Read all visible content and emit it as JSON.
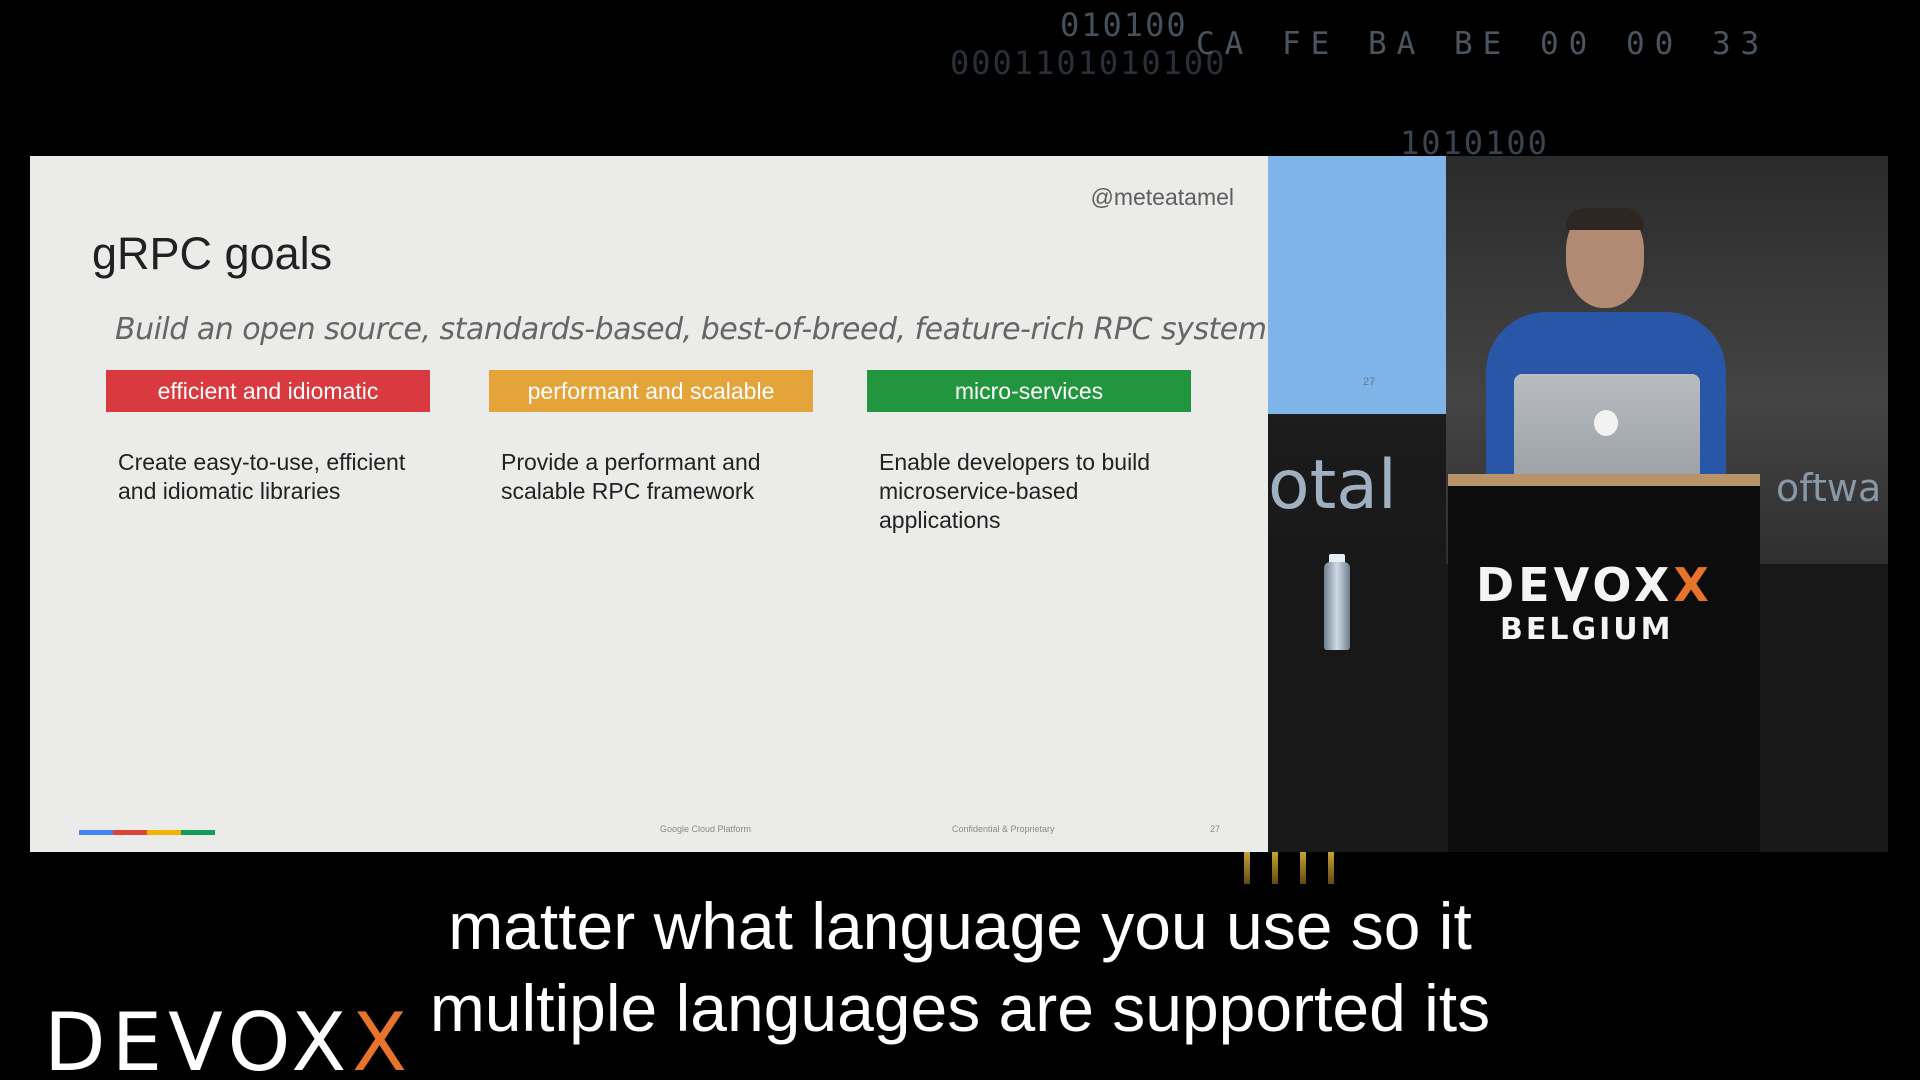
{
  "background": {
    "code_lines": [
      "010100",
      "0001101010100",
      "CA FE BA BE 00 00 33",
      "1010100"
    ]
  },
  "slide": {
    "handle": "@meteatamel",
    "title": "gRPC goals",
    "subtitle": "Build an open source, standards-based, best-of-breed, feature-rich RPC system",
    "goals": [
      {
        "label": "efficient and idiomatic",
        "color": "#d93a3f",
        "description": "Create easy-to-use, efficient and idiomatic libraries"
      },
      {
        "label": "performant and scalable",
        "color": "#e4a43a",
        "description": "Provide a performant and scalable RPC framework"
      },
      {
        "label": "micro-services",
        "color": "#22963f",
        "description": "Enable developers to build microservice-based applications"
      }
    ],
    "footer": {
      "left": "Google Cloud Platform",
      "middle": "Confidential & Proprietary",
      "page": "27"
    },
    "google_bar_colors": [
      "#4285f4",
      "#db4437",
      "#f4b400",
      "#0f9d58"
    ]
  },
  "stage": {
    "screen_page": "27",
    "wall_text_left": "otal",
    "wall_text_right": "oftwa",
    "podium_logo": {
      "text": "DEVOX",
      "accent": "X"
    },
    "podium_sub": "BELGIUM"
  },
  "captions": {
    "line1": "matter what language you use so it",
    "line2": "multiple languages are supported its"
  },
  "watermark": {
    "text": "DEVOX",
    "accent": "X"
  },
  "colors": {
    "accent": "#e8742c",
    "slide_bg": "#ebebe9"
  }
}
